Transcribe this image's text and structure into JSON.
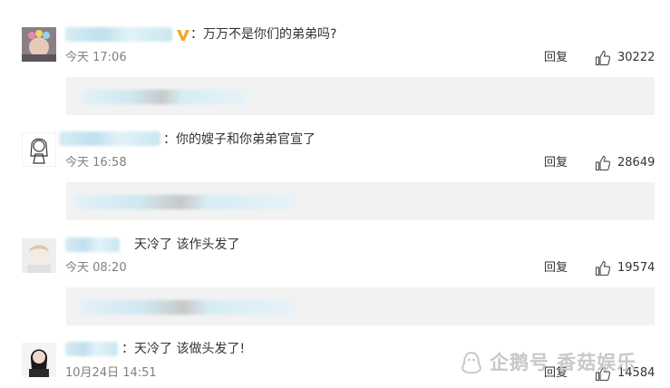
{
  "comments": [
    {
      "text": "：万万不是你们的弟弟吗?",
      "time": "今天 17:06",
      "reply_label": "回复",
      "likes": "30222",
      "verified": true
    },
    {
      "text": "：你的嫂子和你弟弟官宣了",
      "time": "今天 16:58",
      "reply_label": "回复",
      "likes": "28649",
      "verified": false
    },
    {
      "text": "天冷了 该作头发了",
      "time": "今天 08:20",
      "reply_label": "回复",
      "likes": "19574",
      "verified": false
    },
    {
      "text": "：天冷了 该做头发了!",
      "time": "10月24日 14:51",
      "reply_label": "回复",
      "likes": "14584",
      "verified": false
    }
  ],
  "watermark": {
    "text": "企鹅号 香菇娱乐"
  },
  "colors": {
    "verified_badge": "#f5a623",
    "sub_box": "#f2f2f2",
    "time": "#808080"
  },
  "icons": {
    "like": "thumbs-up-icon",
    "verified": "verified-v-icon",
    "watermark": "penguin-icon"
  }
}
